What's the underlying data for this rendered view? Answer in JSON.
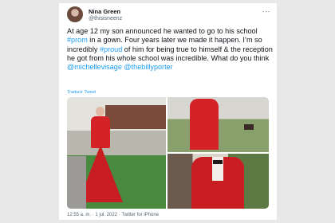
{
  "tweet": {
    "author_name": "Nina Green",
    "author_handle": "@thisisneenz",
    "more_label": "···",
    "text_parts": [
      {
        "text": "At age 12 my son announced he wanted to go to his school ",
        "link": false
      },
      {
        "text": "#prom",
        "link": true
      },
      {
        "text": " in a gown. Four years later we made it happen. I’m so incredibly ",
        "link": false
      },
      {
        "text": "#proud",
        "link": true
      },
      {
        "text": " of him for being true to himself & the reception he got from his whole school was incredible. What do you think ",
        "link": false
      },
      {
        "text": "@michellevisage",
        "link": true
      },
      {
        "text": " ",
        "link": false
      },
      {
        "text": "@thebillyporter",
        "link": true
      }
    ],
    "translate_label": "Traducir Tweet",
    "time": "12:55 a. m.",
    "separator": "·",
    "date": "1 jul. 2022",
    "source": "Twitter for iPhone"
  },
  "colors": {
    "link": "#1d9bf0",
    "text": "#0f1419",
    "muted": "#536471",
    "gown": "#d42226"
  }
}
